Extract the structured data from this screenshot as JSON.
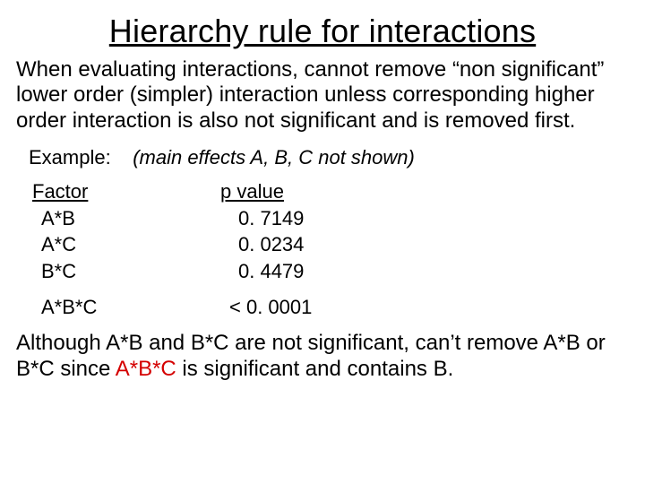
{
  "title": "Hierarchy rule for interactions",
  "intro": "When evaluating interactions, cannot remove “non significant” lower order (simpler) interaction unless corresponding higher order interaction is also not significant and is removed first.",
  "example_label": "Example:",
  "example_note": "(main effects A, B, C not shown)",
  "table": {
    "header_factor": "Factor",
    "header_pvalue": "p value",
    "rows": [
      {
        "factor": "A*B",
        "pvalue": "0. 7149"
      },
      {
        "factor": "A*C",
        "pvalue": "0. 0234"
      },
      {
        "factor": "B*C",
        "pvalue": "0. 4479"
      }
    ],
    "last_row": {
      "factor": "A*B*C",
      "pvalue": "< 0. 0001"
    }
  },
  "conclusion": {
    "part1": "Although A*B and B*C are not significant, can’t remove A*B or B*C since ",
    "highlight": "A*B*C",
    "part2": " is significant and contains B."
  }
}
